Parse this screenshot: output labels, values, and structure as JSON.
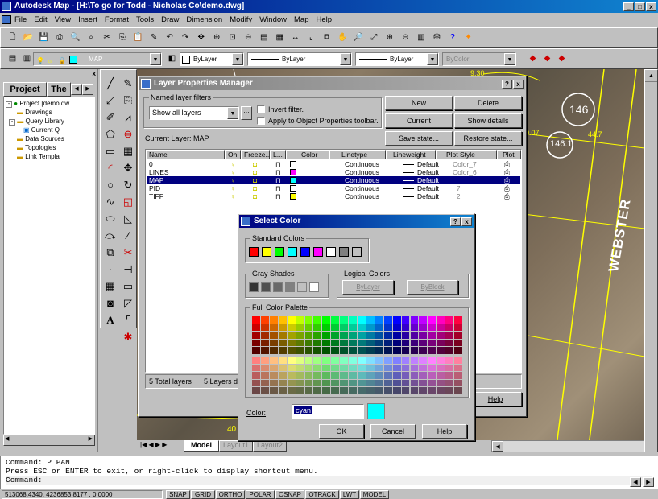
{
  "app": {
    "title": "Autodesk Map - [H:\\To go for Todd - Nicholas Co\\demo.dwg]",
    "menu": [
      "File",
      "Edit",
      "View",
      "Insert",
      "Format",
      "Tools",
      "Draw",
      "Dimension",
      "Modify",
      "Window",
      "Map",
      "Help"
    ]
  },
  "properties_bar": {
    "layer": "MAP",
    "color": "ByLayer",
    "linetype": "ByLayer",
    "lineweight": "ByLayer",
    "plotstyle": "ByColor"
  },
  "workspace": {
    "tabs": [
      "Project",
      "The"
    ],
    "tree": [
      "Project [demo.dw",
      "Drawings",
      "Query Library",
      "Current Q",
      "Data Sources",
      "Topologies",
      "Link Templa"
    ]
  },
  "layer_dialog": {
    "title": "Layer Properties Manager",
    "filters_label": "Named layer filters",
    "filter_value": "Show all layers",
    "invert_filter": "Invert filter.",
    "apply_toolbar": "Apply to Object Properties toolbar.",
    "buttons": {
      "new": "New",
      "delete": "Delete",
      "current": "Current",
      "show_details": "Show details",
      "save_state": "Save state...",
      "restore_state": "Restore state...",
      "help": "Help"
    },
    "current_layer": "Current Layer:  MAP",
    "columns": [
      "Name",
      "On",
      "Freeze...",
      "L...",
      "Color",
      "Linetype",
      "Lineweight",
      "Plot Style",
      "Plot"
    ],
    "layers": [
      {
        "name": "0",
        "linetype": "Continuous",
        "lineweight": "Default",
        "plotstyle": "Color_7",
        "color": "#ffffff"
      },
      {
        "name": "LINES",
        "linetype": "Continuous",
        "lineweight": "Default",
        "plotstyle": "Color_6",
        "color": "#ff00ff"
      },
      {
        "name": "MAP",
        "linetype": "Continuous",
        "lineweight": "Default",
        "plotstyle": "",
        "color": "#00ffff"
      },
      {
        "name": "PID",
        "linetype": "Continuous",
        "lineweight": "Default",
        "plotstyle": "_7",
        "color": "#ffffff"
      },
      {
        "name": "TIFF",
        "linetype": "Continuous",
        "lineweight": "Default",
        "plotstyle": "_2",
        "color": "#ffff00"
      }
    ],
    "selected_layer": "MAP",
    "status_total": "5 Total layers",
    "status_displayed": "5 Layers displayed"
  },
  "select_color": {
    "title": "Select Color",
    "standard_label": "Standard Colors",
    "standard_colors": [
      "#ff0000",
      "#ffff00",
      "#00ff00",
      "#00ffff",
      "#0000ff",
      "#ff00ff",
      "#ffffff",
      "#808080",
      "#c0c0c0"
    ],
    "gray_label": "Gray Shades",
    "gray_colors": [
      "#333333",
      "#505050",
      "#696969",
      "#808080",
      "#c0c0c0",
      "#ffffff"
    ],
    "logical_label": "Logical Colors",
    "bylayer": "ByLayer",
    "byblock": "ByBlock",
    "palette_label": "Full Color Palette",
    "color_label": "Color:",
    "color_value": "cyan",
    "ok": "OK",
    "cancel": "Cancel",
    "help": "Help"
  },
  "map": {
    "street_label": "WEBSTER",
    "parcel_labels": [
      "146",
      "146.1",
      "50.07",
      "44.7",
      "9.30",
      "40"
    ],
    "tabs": [
      "Model",
      "Layout1",
      "Layout2"
    ]
  },
  "command": {
    "lines": [
      "Command: P PAN",
      "Press ESC or ENTER to exit, or right-click to display shortcut menu.",
      "Command:"
    ]
  },
  "status": {
    "coords": "513068.4340, 4236853.8177 , 0.0000",
    "toggles": [
      "SNAP",
      "GRID",
      "ORTHO",
      "POLAR",
      "OSNAP",
      "OTRACK",
      "LWT",
      "MODEL"
    ]
  }
}
